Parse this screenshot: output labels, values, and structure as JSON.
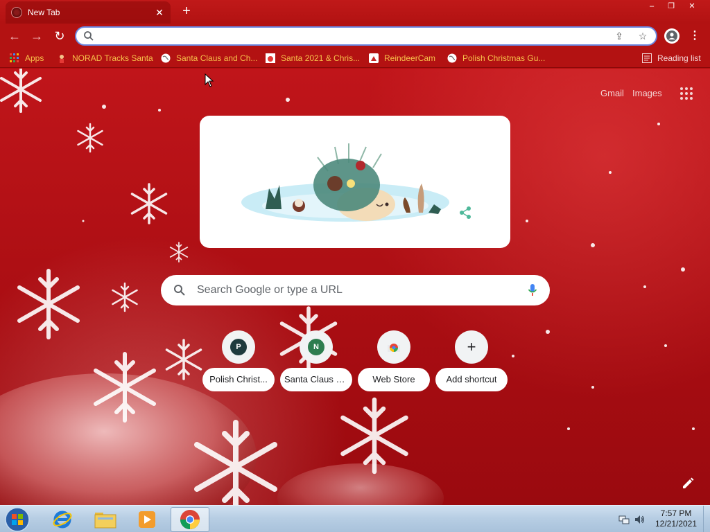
{
  "tab": {
    "title": "New Tab",
    "close": "✕"
  },
  "window": {
    "minimize": "–",
    "maximize": "❐",
    "close": "✕"
  },
  "toolbar": {
    "back": "←",
    "forward": "→",
    "reload": "↻",
    "omnibox_value": "",
    "share": "⇪",
    "star": "☆",
    "menu": "⋮"
  },
  "bookmarks": {
    "apps": "Apps",
    "norad": "NORAD Tracks Santa",
    "santa_claus": "Santa Claus and Ch...",
    "santa_2021": "Santa 2021 & Chris...",
    "reindeercam": "ReindeerCam",
    "polish": "Polish Christmas Gu...",
    "reading_list": "Reading list"
  },
  "ntp": {
    "gmail": "Gmail",
    "images": "Images",
    "search_placeholder": "Search Google or type a URL",
    "shortcuts": [
      {
        "letter": "P",
        "label": "Polish Christ...",
        "color": "#1f3b3e"
      },
      {
        "letter": "N",
        "label": "Santa Claus a...",
        "color": "#2e7d4f"
      },
      {
        "letter": "",
        "label": "Web Store"
      },
      {
        "letter": "+",
        "label": "Add shortcut"
      }
    ]
  },
  "taskbar": {
    "time": "7:57 PM",
    "date": "12/21/2021"
  },
  "colors": {
    "chrome_red": "#b31212",
    "bookmark_text": "#f7c14a",
    "omnibox_focus": "#6a86e0"
  }
}
